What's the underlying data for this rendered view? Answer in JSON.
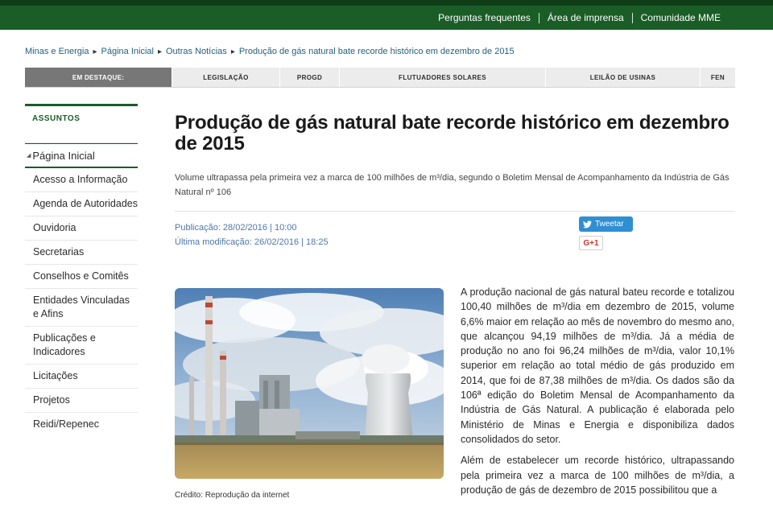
{
  "top_links": [
    "Perguntas frequentes",
    "Área de imprensa",
    "Comunidade MME"
  ],
  "breadcrumb": [
    "Minas e Energia",
    "Página Inicial",
    "Outras Notícias",
    "Produção de gás natural bate recorde histórico em dezembro de 2015"
  ],
  "topic_bar": {
    "label": "EM DESTAQUE:",
    "items": [
      "LEGISLAÇÃO",
      "PROGD",
      "FLUTUADORES SOLARES",
      "LEILÃO DE USINAS",
      "FEN"
    ]
  },
  "sidebar": {
    "heading": "ASSUNTOS",
    "home": "Página Inicial",
    "items": [
      "Acesso a Informação",
      "Agenda de Autoridades",
      "Ouvidoria",
      "Secretarias",
      "Conselhos e Comitês",
      "Entidades Vinculadas e Afins",
      "Publicações e Indicadores",
      "Licitações",
      "Projetos",
      "Reidi/Repenec"
    ]
  },
  "article": {
    "title": "Produção de gás natural bate recorde histórico em dezembro de 2015",
    "subtitle": "Volume ultrapassa pela primeira vez a marca de 100 milhões de m³/dia, segundo o Boletim Mensal de Acompanhamento da Indústria de Gás Natural nº 106",
    "published": "Publicação: 28/02/2016 | 10:00",
    "modified": "Última modificação: 26/02/2016 | 18:25",
    "tweet_label": "Tweetar",
    "gplus_label": "G+1",
    "photo_credit": "Crédito: Reprodução da internet",
    "paragraphs": [
      "A produção nacional de gás natural bateu recorde e totalizou 100,40 milhões de m³/dia em dezembro de 2015, volume 6,6% maior em relação ao mês de novembro do mesmo ano, que alcançou 94,19 milhões de m³/dia. Já a média de produção no ano foi 96,24 milhões de m³/dia, valor 10,1% superior em relação ao total médio de gás produzido em 2014, que foi de 87,38 milhões de m³/dia. Os dados são da 106ª edição do Boletim Mensal de Acompanhamento da Indústria de Gás Natural. A publicação é elaborada pelo Ministério de Minas e Energia e disponibiliza dados consolidados do setor.",
      "Além de estabelecer um recorde histórico, ultrapassando pela primeira vez a marca de 100 milhões de m³/dia, a produção de gás de dezembro de 2015 possibilitou que a"
    ]
  },
  "colors": {
    "brand_green": "#1a5d27",
    "link_blue": "#1f5f7d",
    "meta_blue": "#4c78a8",
    "twitter_blue": "#2f8fd3"
  }
}
